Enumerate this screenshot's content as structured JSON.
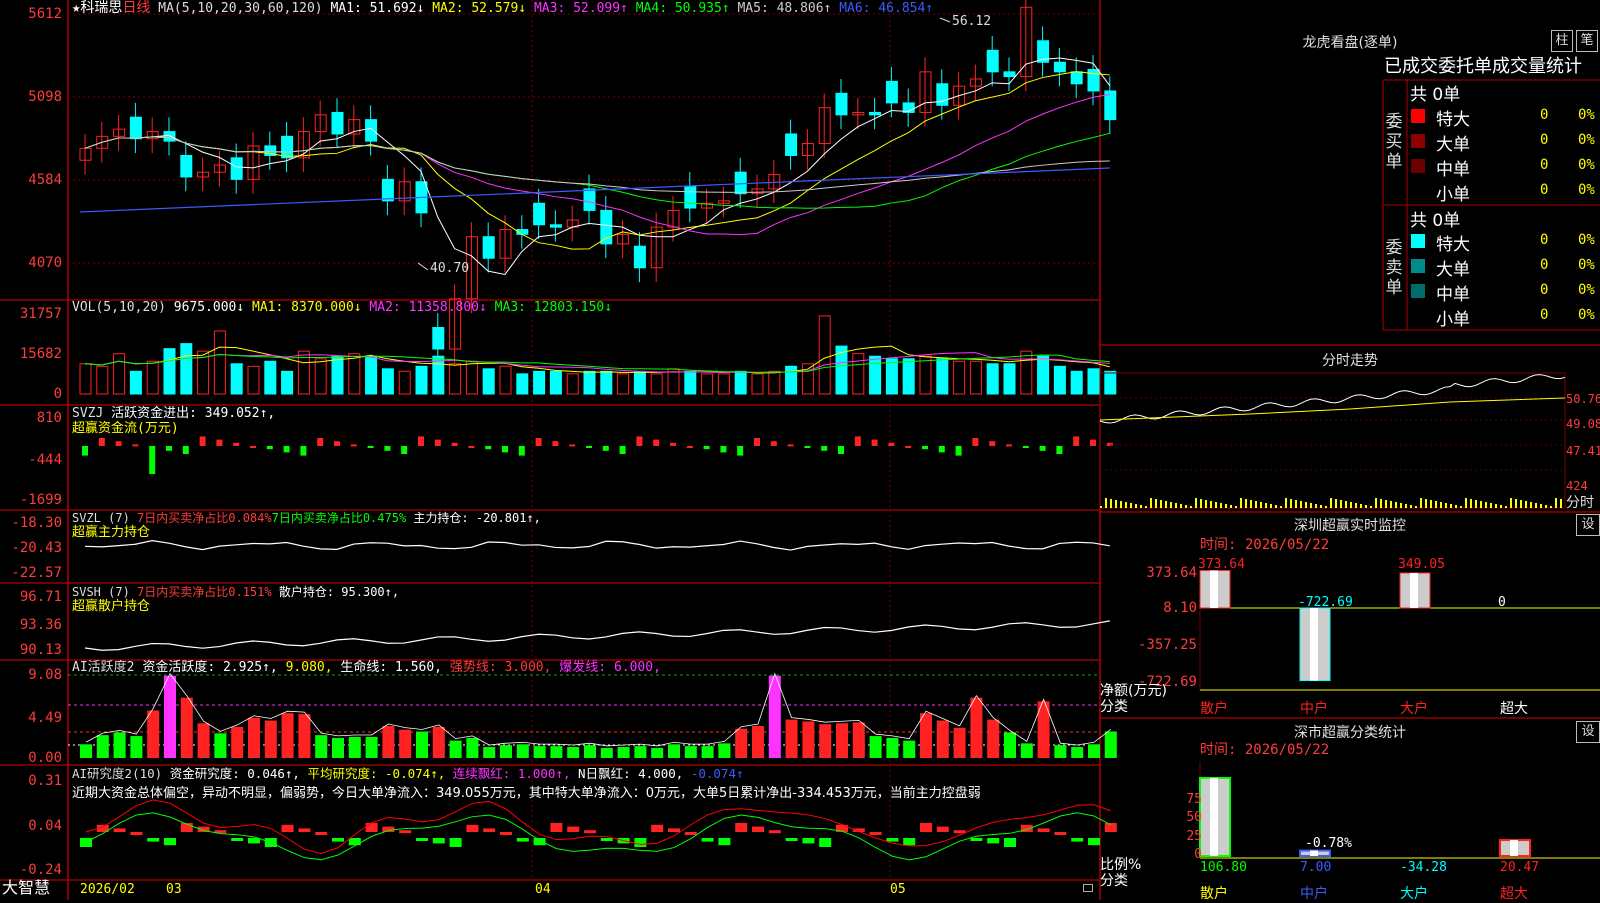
{
  "stock": {
    "name": "★科瑞思",
    "period": "日线"
  },
  "candle": {
    "ma_header": "MA(5,10,20,30,60,120)",
    "ma_values": [
      {
        "text": "MA1: 51.692↓",
        "color": "#ffffff"
      },
      {
        "text": "MA2: 52.579↓",
        "color": "#ffff00"
      },
      {
        "text": "MA3: 52.099↑",
        "color": "#ff33ff"
      },
      {
        "text": "MA4: 50.935↑",
        "color": "#00ff00"
      },
      {
        "text": "MA5: 48.806↑",
        "color": "#cccccc"
      },
      {
        "text": "MA6: 46.854↑",
        "color": "#3b5bff"
      }
    ],
    "y_labels": [
      "5612",
      "5098",
      "4584",
      "4070"
    ],
    "high_label": "56.12",
    "low_label": "40.70"
  },
  "volume": {
    "header": "VOL(5,10,20)",
    "value": "9675.000↓",
    "ma": [
      {
        "text": "MA1: 8370.000↓",
        "color": "#ffff00"
      },
      {
        "text": "MA2: 11358.800↓",
        "color": "#ff33ff"
      },
      {
        "text": "MA3: 12803.150↓",
        "color": "#00ff00"
      }
    ],
    "y_labels": [
      "31757",
      "15682",
      "0"
    ]
  },
  "svzj": {
    "header": "SVZJ",
    "line1": "活跃资金进出: 349.052↑,",
    "line2": "超赢资金流(万元)",
    "y_labels": [
      "810",
      "-444",
      "-1699"
    ]
  },
  "svzl": {
    "header": "SVZL (7)",
    "a": "7日内买卖净占比0.084%",
    "b": "7日内买卖净占比0.475%",
    "c": "主力持仓: -20.801↑,",
    "line2": "超赢主力持仓",
    "y_labels": [
      "-18.30",
      "-20.43",
      "-22.57"
    ]
  },
  "svsh": {
    "header": "SVSH (7)",
    "a": "7日内买卖净占比0.151%",
    "b": "散户持仓: 95.300↑,",
    "line2": "超赢散户持仓",
    "y_labels": [
      "96.71",
      "93.36",
      "90.13"
    ]
  },
  "ai1": {
    "header": "AI活跃度2",
    "a": "资金活跃度: 2.925↑,",
    "b": "9.080,",
    "c": "生命线: 1.560,",
    "d": "强势线: 3.000,",
    "e": "爆发线: 6.000,",
    "y_labels": [
      "9.08",
      "4.49",
      "0.00"
    ]
  },
  "ai2": {
    "header": "AI研究度2(10)",
    "a": "资金研究度: 0.046↑,",
    "b": "平均研究度: -0.074↑,",
    "c": "连续飘红: 1.000↑,",
    "d": "N日飘红: 4.000,",
    "e": "-0.074↑",
    "note": "近期大资金总体偏空，异动不明显，偏弱势，今日大单净流入：349.055万元，其中特大单净流入：0万元，大单5日累计净出-334.453万元，当前主力控盘弱",
    "y_labels": [
      "0.31",
      "0.04",
      "-0.24"
    ]
  },
  "bottom": {
    "brand": "大智慧",
    "dates": [
      "2026/02",
      "03",
      "04",
      "05"
    ]
  },
  "dragon": {
    "title": "龙虎看盘(逐单)",
    "tab1": "柱",
    "tab2": "笔",
    "subtitle": "已成交委托单成交量统计",
    "buy_side": "委买单",
    "sell_side": "委卖单",
    "buy_total": "共 0单",
    "sell_total": "共 0单",
    "buy_rows": [
      {
        "label": "特大",
        "count": "0",
        "pct": "0%",
        "color": "#ff0000"
      },
      {
        "label": "大单",
        "count": "0",
        "pct": "0%",
        "color": "#8b0000"
      },
      {
        "label": "中单",
        "count": "0",
        "pct": "0%",
        "color": "#6b0000"
      },
      {
        "label": "小单",
        "count": "0",
        "pct": "0%",
        "color": ""
      }
    ],
    "sell_rows": [
      {
        "label": "特大",
        "count": "0",
        "pct": "0%",
        "color": "#00ffff"
      },
      {
        "label": "大单",
        "count": "0",
        "pct": "0%",
        "color": "#008b8b"
      },
      {
        "label": "中单",
        "count": "0",
        "pct": "0%",
        "color": "#006b6b"
      },
      {
        "label": "小单",
        "count": "0",
        "pct": "0%",
        "color": ""
      }
    ]
  },
  "intraday": {
    "title": "分时走势",
    "y_labels": [
      "50.76",
      "49.08",
      "47.41",
      "424"
    ],
    "vol_label": "分时"
  },
  "monitor": {
    "title": "深圳超赢实时监控",
    "setting": "设",
    "time": "时间: 2026/05/22",
    "y_labels": [
      "373.64",
      "8.10",
      "-357.25",
      "-722.69"
    ],
    "y_unit": "净额(万元)",
    "x_unit": "分类",
    "categories": [
      "散户",
      "中户",
      "大户",
      "超大"
    ],
    "values": [
      "373.64",
      "-722.69",
      "349.05",
      "0"
    ]
  },
  "classify": {
    "title": "深市超赢分类统计",
    "setting": "设",
    "time": "时间: 2026/05/22",
    "y_labels": [
      "75",
      "50",
      "25",
      "0"
    ],
    "y_unit": "比例%",
    "x_unit": "分类",
    "categories": [
      "散户",
      "中户",
      "大户",
      "超大"
    ],
    "values": [
      "106.80",
      "7.00",
      "-34.28",
      "20.47"
    ],
    "mid_label": "-0.78%"
  },
  "colors": {
    "up": "#ff2222",
    "down": "#00ffff",
    "frame": "#b00000"
  }
}
